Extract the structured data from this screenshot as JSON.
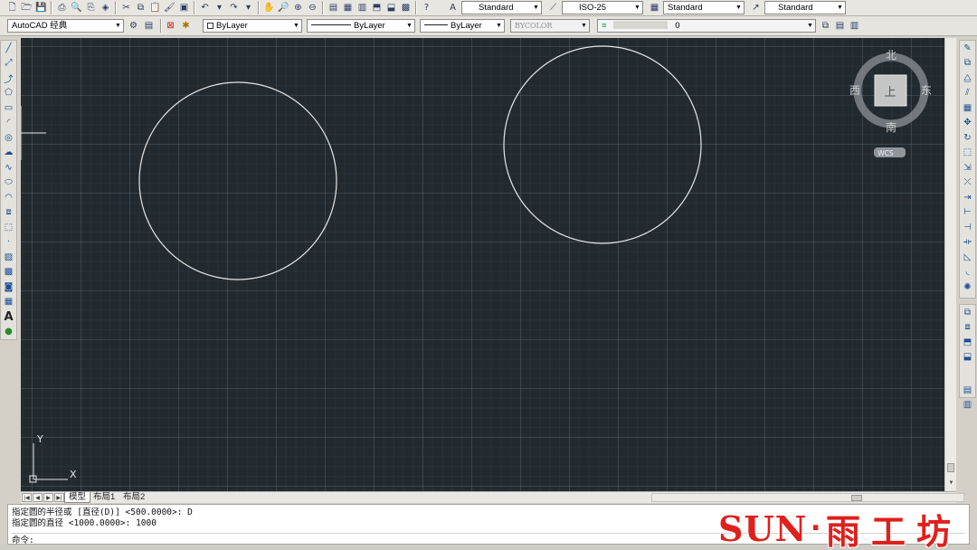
{
  "toolbar_row1": {
    "text_style": "Standard",
    "dim_style": "ISO-25",
    "table_style": "Standard",
    "multileader_style": "Standard"
  },
  "toolbar_row2": {
    "workspace": "AutoCAD 经典",
    "layer": "ByLayer",
    "linetype": "ByLayer",
    "lineweight": "ByLayer",
    "plot_style": "BYCOLOR",
    "layer_combo_value": "0"
  },
  "viewcube": {
    "north": "北",
    "south": "南",
    "east": "东",
    "west": "西",
    "top": "上",
    "ucs_badge": "WCS"
  },
  "ucs_icon": {
    "x_label": "X",
    "y_label": "Y"
  },
  "layout_tabs": [
    {
      "label": "模型",
      "active": true
    },
    {
      "label": "布局1",
      "active": false
    },
    {
      "label": "布局2",
      "active": false
    }
  ],
  "command_line": {
    "history": [
      "指定圆的半径或 [直径(D)] <500.0000>: D",
      "指定圆的直径 <1000.0000>: 1000"
    ],
    "prompt": "命令:"
  },
  "watermark": {
    "text_latin": "SUN",
    "separator": "·",
    "text_cjk": "雨工坊"
  },
  "colors": {
    "canvas_bg": "#222a30",
    "geometry_stroke": "#e6e6e6",
    "watermark_red": "#e0201c"
  }
}
